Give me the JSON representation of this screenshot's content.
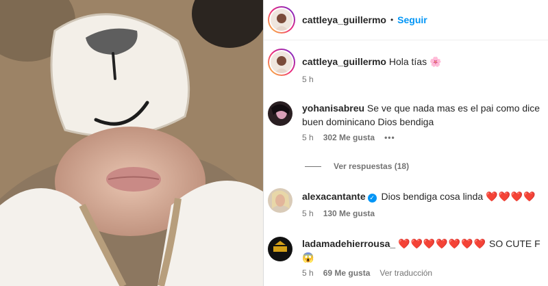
{
  "header": {
    "username": "cattleya_guillermo",
    "separator": "•",
    "follow_label": "Seguir"
  },
  "caption": {
    "username": "cattleya_guillermo",
    "text": "Hola tías 🌸",
    "time": "5 h"
  },
  "comments": [
    {
      "username": "yohanisabreu",
      "text_line1": "Se ve que nada mas es el pai como dice",
      "text_line2": "buen dominicano Dios bendiga",
      "time": "5 h",
      "likes": "302 Me gusta",
      "more": "•••",
      "replies_label": "Ver respuestas (18)"
    },
    {
      "username": "alexacantante",
      "verified": true,
      "text": "Dios bendiga cosa linda",
      "hearts": "❤️❤️❤️❤️",
      "time": "5 h",
      "likes": "130 Me gusta"
    },
    {
      "username": "ladamadehierrousa_",
      "hearts": "❤️❤️❤️❤️❤️❤️❤️",
      "text": "SO CUTE F",
      "text_line2": "😱",
      "time": "5 h",
      "likes": "69 Me gusta",
      "translate_label": "Ver traducción"
    }
  ],
  "colors": {
    "link": "#0095f6",
    "meta": "#737373",
    "heart": "#e0182d"
  }
}
